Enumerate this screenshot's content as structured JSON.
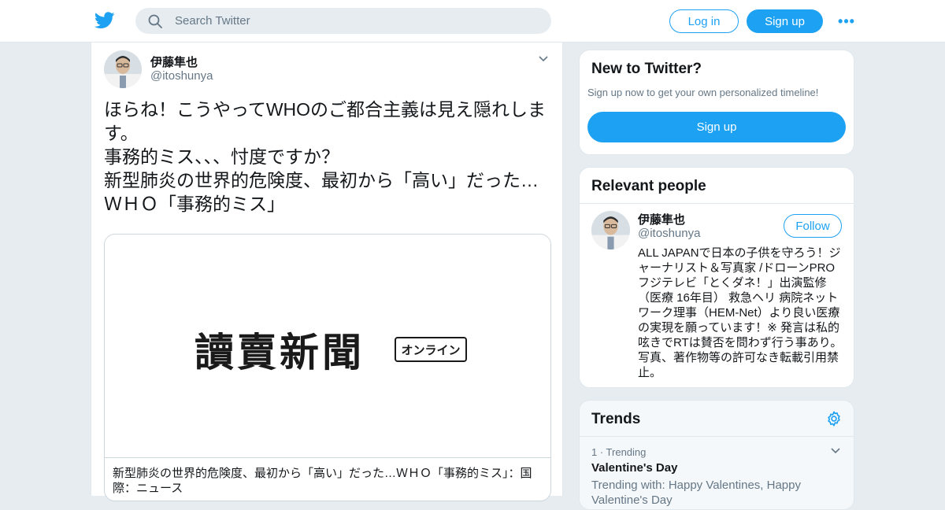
{
  "header": {
    "search_placeholder": "Search Twitter",
    "login_label": "Log in",
    "signup_label": "Sign up",
    "more_label": "•••",
    "brand_color": "#1da1f2"
  },
  "tweet": {
    "author_name": "伊藤隼也",
    "author_handle": "@itoshunya",
    "text": "ほらね！こうやってWHOのご都合主義は見え隠れします。\n事務的ミス、、、忖度ですか？\n新型肺炎の世界的危険度、最初から「高い」だった…ＷＨＯ「事務的ミス」",
    "card": {
      "logo_text": "讀賣新聞",
      "logo_badge": "オンライン",
      "title": "新型肺炎の世界的危険度、最初から「高い」だった…ＷＨＯ「事務的ミス」：国際：ニュース"
    }
  },
  "new_to_twitter": {
    "title": "New to Twitter?",
    "subtitle": "Sign up now to get your own personalized timeline!",
    "button_label": "Sign up"
  },
  "relevant_people": {
    "title": "Relevant people",
    "person": {
      "name": "伊藤隼也",
      "handle": "@itoshunya",
      "follow_label": "Follow",
      "bio": "ALL JAPANで日本の子供を守ろう！ジャーナリスト＆写真家 /ドローンPRO フジテレビ「とくダネ！」出演監修（医療 16年目） 救急ヘリ 病院ネットワーク理事（HEM-Net）より良い医療の実現を願っています！※ 発言は私的呟きでRTは賛否を問わず行う事あり。写真、著作物等の許可なき転載引用禁止。"
    }
  },
  "trends": {
    "title": "Trends",
    "items": [
      {
        "rank_label": "1 · Trending",
        "name": "Valentine's Day",
        "trending_with": "Trending with: Happy Valentines, Happy Valentine's Day"
      }
    ]
  }
}
